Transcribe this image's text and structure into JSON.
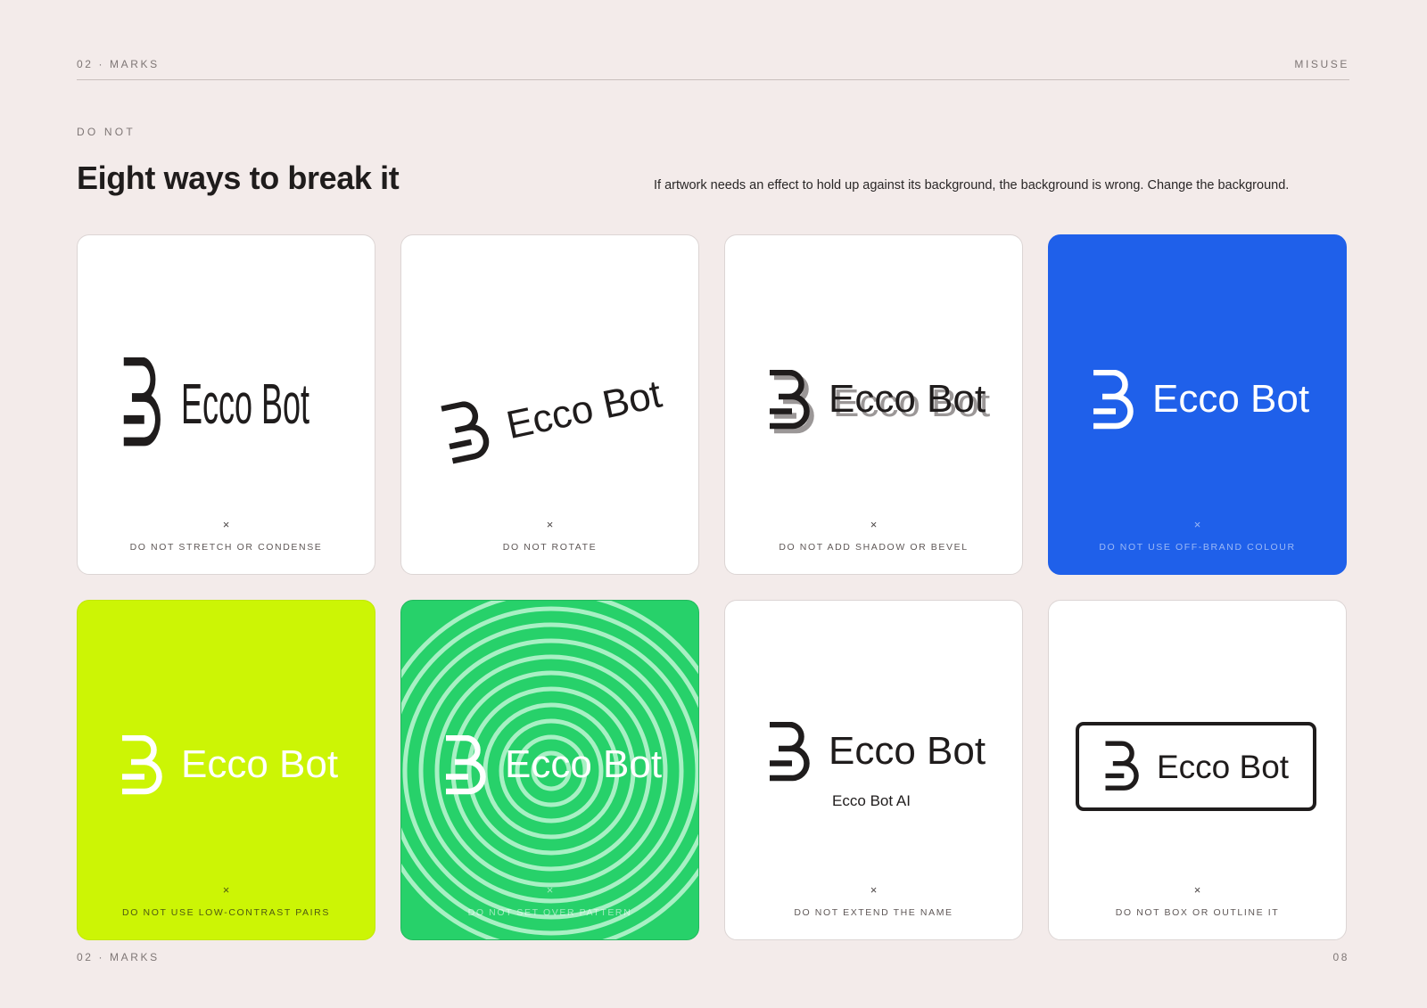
{
  "header": {
    "section": "02 · MARKS",
    "topic": "MISUSE"
  },
  "eyebrow": "DO NOT",
  "title": "Eight ways to break it",
  "lede": "If artwork needs an effect to hold up against its background, the background is wrong. Change the background.",
  "brand": {
    "wordmark": "Ecco Bot",
    "extended_name": "Ecco Bot AI"
  },
  "colors": {
    "page": "#f3ebea",
    "ink": "#1f1c1c",
    "off_brand_blue": "#1f60ea",
    "lime": "#ccf505",
    "green": "#27d16a"
  },
  "cards": [
    {
      "mark": "×",
      "caption": "DO NOT STRETCH OR CONDENSE"
    },
    {
      "mark": "×",
      "caption": "DO NOT ROTATE"
    },
    {
      "mark": "×",
      "caption": "DO NOT ADD SHADOW OR BEVEL"
    },
    {
      "mark": "×",
      "caption": "DO NOT USE OFF-BRAND COLOUR"
    },
    {
      "mark": "×",
      "caption": "DO NOT USE LOW-CONTRAST PAIRS"
    },
    {
      "mark": "×",
      "caption": "DO NOT SET OVER PATTERN"
    },
    {
      "mark": "×",
      "caption": "DO NOT EXTEND THE NAME"
    },
    {
      "mark": "×",
      "caption": "DO NOT BOX OR OUTLINE IT"
    }
  ],
  "footer": {
    "section": "02 · MARKS",
    "page": "08"
  }
}
